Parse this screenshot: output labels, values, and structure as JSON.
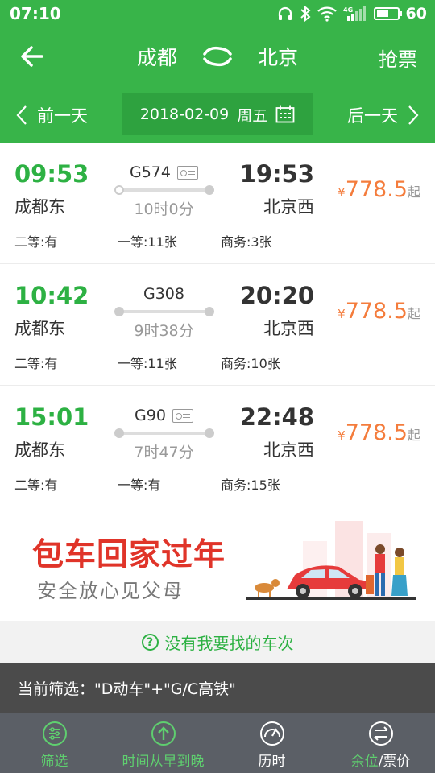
{
  "status_bar": {
    "time": "07:10",
    "network_label": "4G",
    "battery": "60",
    "battery_level": 0.6
  },
  "header": {
    "from": "成都",
    "to": "北京",
    "grab_label": "抢票"
  },
  "date_bar": {
    "prev_label": "前一天",
    "date": "2018-02-09",
    "weekday": "周五",
    "next_label": "后一天"
  },
  "trains": [
    {
      "dep_time": "09:53",
      "dep_station": "成都东",
      "train_no": "G574",
      "has_id_icon": true,
      "duration": "10时0分",
      "arr_time": "19:53",
      "arr_station": "北京西",
      "price_currency": "¥",
      "price": "778.5",
      "price_suffix": "起",
      "seat_second": "二等:有",
      "seat_first": "一等:11张",
      "seat_business": "商务:3张"
    },
    {
      "dep_time": "10:42",
      "dep_station": "成都东",
      "train_no": "G308",
      "has_id_icon": false,
      "duration": "9时38分",
      "arr_time": "20:20",
      "arr_station": "北京西",
      "price_currency": "¥",
      "price": "778.5",
      "price_suffix": "起",
      "seat_second": "二等:有",
      "seat_first": "一等:11张",
      "seat_business": "商务:10张"
    },
    {
      "dep_time": "15:01",
      "dep_station": "成都东",
      "train_no": "G90",
      "has_id_icon": true,
      "duration": "7时47分",
      "arr_time": "22:48",
      "arr_station": "北京西",
      "price_currency": "¥",
      "price": "778.5",
      "price_suffix": "起",
      "seat_second": "二等:有",
      "seat_first": "一等:有",
      "seat_business": "商务:15张"
    }
  ],
  "banner": {
    "title": "包车回家过年",
    "subtitle": "安全放心见父母"
  },
  "not_found": {
    "label": "没有我要找的车次"
  },
  "filter": {
    "label": "当前筛选：\"D动车\"+\"G/C高铁\""
  },
  "bottom_nav": {
    "filter": "筛选",
    "time_order": "时间从早到晚",
    "duration": "历时",
    "seats_part": "余位",
    "price_part": "/票价"
  },
  "colors": {
    "brand_green": "#38b449",
    "price_orange": "#f47c3c",
    "active_nav_green": "#5fcf6f"
  }
}
